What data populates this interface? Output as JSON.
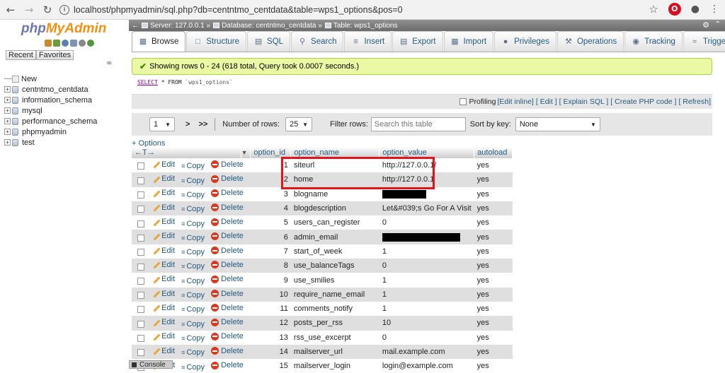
{
  "browser": {
    "url": "localhost/phpmyadmin/sql.php?db=centntmo_centdata&table=wps1_options&pos=0"
  },
  "sidebar": {
    "logo_php": "php",
    "logo_my": "MyAdmin",
    "recent": "Recent",
    "favorites": "Favorites",
    "items": [
      {
        "label": "New"
      },
      {
        "label": "centntmo_centdata"
      },
      {
        "label": "information_schema"
      },
      {
        "label": "mysql"
      },
      {
        "label": "performance_schema"
      },
      {
        "label": "phpmyadmin"
      },
      {
        "label": "test"
      }
    ]
  },
  "breadcrumb": {
    "server": "Server: 127.0.0.1 »",
    "database": "Database: centntmo_centdata »",
    "table": "Table: wps1_options"
  },
  "tabs": [
    {
      "label": "Browse",
      "icon": "browse-icon"
    },
    {
      "label": "Structure",
      "icon": "structure-icon"
    },
    {
      "label": "SQL",
      "icon": "sql-icon"
    },
    {
      "label": "Search",
      "icon": "search-icon"
    },
    {
      "label": "Insert",
      "icon": "insert-icon"
    },
    {
      "label": "Export",
      "icon": "export-icon"
    },
    {
      "label": "Import",
      "icon": "import-icon"
    },
    {
      "label": "Privileges",
      "icon": "privileges-icon"
    },
    {
      "label": "Operations",
      "icon": "operations-icon"
    },
    {
      "label": "Tracking",
      "icon": "tracking-icon"
    },
    {
      "label": "Triggers",
      "icon": "triggers-icon"
    }
  ],
  "message": "Showing rows 0 - 24 (618 total, Query took 0.0007 seconds.)",
  "sql": {
    "select": "SELECT",
    "rest": " * FROM ",
    "table": "`wps1_options`"
  },
  "profiling": {
    "label": "Profiling",
    "edit_inline": "[Edit inline]",
    "edit": "[ Edit ]",
    "explain": "[ Explain SQL ]",
    "create_php": "[ Create PHP code ]",
    "refresh": "[ Refresh]"
  },
  "nav": {
    "page": "1",
    "next": ">",
    "last": ">>",
    "rows_label": "Number of rows:",
    "rows_value": "25",
    "filter_label": "Filter rows:",
    "filter_placeholder": "Search this table",
    "sort_label": "Sort by key:",
    "sort_value": "None"
  },
  "options_link": "+ Options",
  "columns": {
    "id": "option_id",
    "name": "option_name",
    "value": "option_value",
    "autoload": "autoload"
  },
  "actions": {
    "edit": "Edit",
    "copy": "Copy",
    "delete": "Delete"
  },
  "rows": [
    {
      "id": "1",
      "name": "siteurl",
      "value": "http://127.0.0.1/",
      "autoload": "yes"
    },
    {
      "id": "2",
      "name": "home",
      "value": "http://127.0.0.1",
      "autoload": "yes"
    },
    {
      "id": "3",
      "name": "blogname",
      "value": "",
      "autoload": "yes"
    },
    {
      "id": "4",
      "name": "blogdescription",
      "value": "Let&#039;s Go For A Visit",
      "autoload": "yes"
    },
    {
      "id": "5",
      "name": "users_can_register",
      "value": "0",
      "autoload": "yes"
    },
    {
      "id": "6",
      "name": "admin_email",
      "value": "",
      "autoload": "yes"
    },
    {
      "id": "7",
      "name": "start_of_week",
      "value": "1",
      "autoload": "yes"
    },
    {
      "id": "8",
      "name": "use_balanceTags",
      "value": "0",
      "autoload": "yes"
    },
    {
      "id": "9",
      "name": "use_smilies",
      "value": "1",
      "autoload": "yes"
    },
    {
      "id": "10",
      "name": "require_name_email",
      "value": "1",
      "autoload": "yes"
    },
    {
      "id": "11",
      "name": "comments_notify",
      "value": "1",
      "autoload": "yes"
    },
    {
      "id": "12",
      "name": "posts_per_rss",
      "value": "10",
      "autoload": "yes"
    },
    {
      "id": "13",
      "name": "rss_use_excerpt",
      "value": "0",
      "autoload": "yes"
    },
    {
      "id": "14",
      "name": "mailserver_url",
      "value": "mail.example.com",
      "autoload": "yes"
    },
    {
      "id": "15",
      "name": "mailserver_login",
      "value": "login@example.com",
      "autoload": "yes"
    }
  ],
  "console": "Console",
  "colors": {
    "link": "#235a81",
    "success_bg": "#ebf8a4",
    "highlight": "#e0161c"
  }
}
